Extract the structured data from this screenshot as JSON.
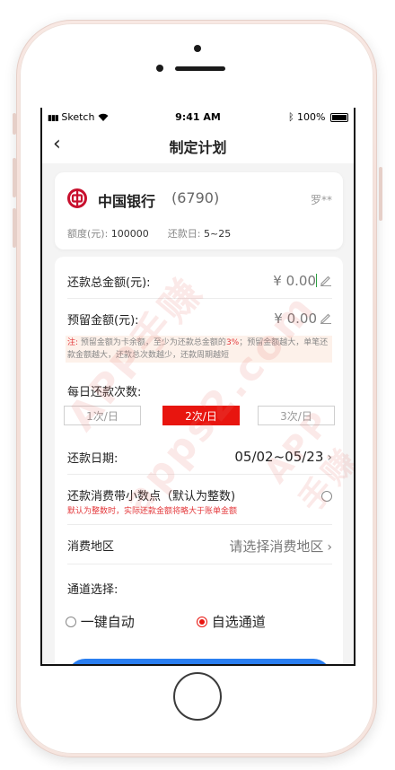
{
  "status_bar": {
    "carrier": "Sketch",
    "time": "9:41 AM",
    "battery": "100%"
  },
  "nav": {
    "back_glyph": "‹",
    "title": "制定计划"
  },
  "bank_card": {
    "bank_name": "中国银行",
    "card_suffix": "(6790)",
    "holder": "罗**",
    "limit_label": "额度(元):",
    "limit_value": "100000",
    "repay_label": "还款日:",
    "repay_value": "5~25"
  },
  "form": {
    "total_label": "还款总金额(元):",
    "total_value": "¥ 0.00",
    "reserve_label": "预留金额(元):",
    "reserve_value": "¥ 0.00",
    "note_prefix": "注:",
    "note_text1": "预留金额为卡余额，至少为还款总金额的",
    "note_pct": "3%",
    "note_text2": "；预留金额越大，单笔还款金额越大，还款总次数越少，还款周期越短",
    "daily_label": "每日还款次数:",
    "daily_options": [
      "1次/日",
      "2次/日",
      "3次/日"
    ],
    "daily_selected": "2次/日",
    "date_label": "还款日期:",
    "date_value": "05/02~05/23",
    "decimal_label": "还款消费带小数点（默认为整数)",
    "decimal_warning": "默认为整数时，实际还款金额将略大于账单金额",
    "region_label": "消费地区",
    "region_placeholder": "请选择消费地区",
    "channel_label": "通道选择:",
    "channel_options": [
      "一键自动",
      "自选通道"
    ],
    "channel_selected": "自选通道"
  },
  "colors": {
    "accent_red": "#e8150f",
    "button_blue": "#2a7ef0",
    "bank_red": "#c8102e"
  },
  "watermark": "APP手赚 apps2.com"
}
